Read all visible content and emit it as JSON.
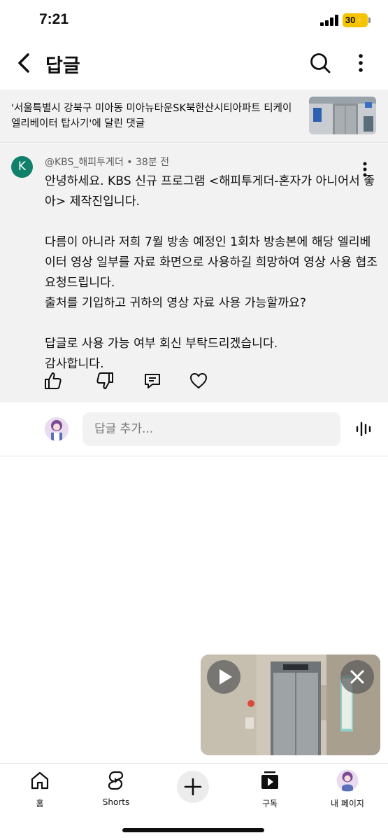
{
  "status_bar": {
    "time": "7:21",
    "battery": "30"
  },
  "header": {
    "title": "답글",
    "back_icon": "chevron-left-icon",
    "search_icon": "search-icon",
    "more_icon": "more-vertical-icon"
  },
  "context": {
    "text": "'서울특별시 강북구 미아동 미아뉴타운SK북한산시티아파트 티케이 엘리베이터 탑사기'에 달린 댓글"
  },
  "comment": {
    "avatar_letter": "K",
    "author": "@KBS_해피투게더",
    "separator": "•",
    "time": "38분 전",
    "body": "안녕하세요. KBS 신규 프로그램 <해피투게더-혼자가 아니어서 좋아> 제작진입니다.\n\n다름이 아니라 저희 7월 방송 예정인 1회차 방송본에 해당 엘리베이터 영상 일부를 자료 화면으로 사용하길 희망하여 영상 사용 협조 요청드립니다.\n출처를 기입하고 귀하의 영상 자료 사용 가능할까요?\n\n답글로 사용 가능 여부 회신 부탁드리겠습니다.\n감사합니다.",
    "actions": [
      "like-icon",
      "dislike-icon",
      "reply-icon",
      "heart-icon"
    ]
  },
  "reply": {
    "placeholder": "답글 추가..."
  },
  "mini_player": {
    "play_icon": "play-icon",
    "close_icon": "close-icon"
  },
  "nav": {
    "home": "홈",
    "shorts": "Shorts",
    "subscriptions": "구독",
    "you": "내 페이지"
  },
  "colors": {
    "avatar_k": "#11806a",
    "battery": "#f5c400",
    "surface": "#f2f2f2"
  }
}
